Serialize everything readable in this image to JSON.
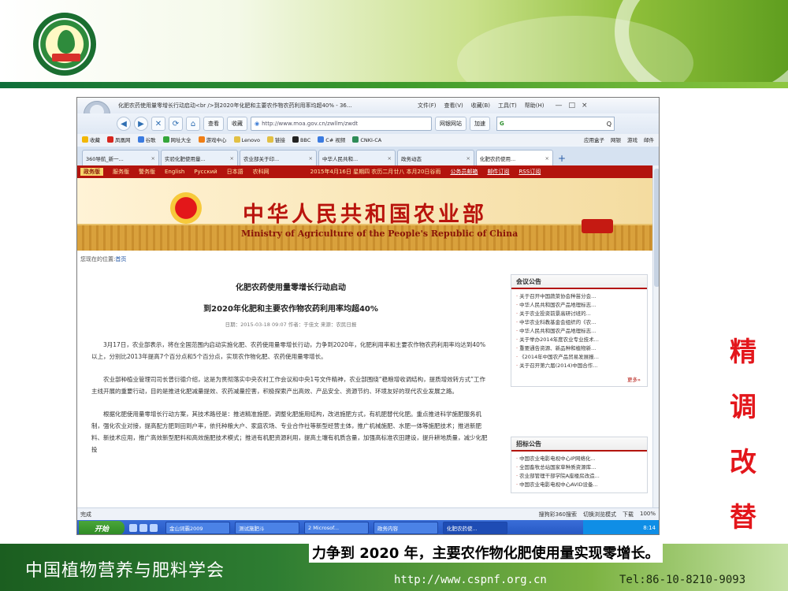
{
  "slide": {
    "vertical_title": [
      "精",
      "调",
      "改",
      "替"
    ],
    "caption": "力争到 2020 年，主要农作物化肥使用量实现零增长。",
    "footer_org": "中国植物营养与肥料学会",
    "footer_url": "http://www.cspnf.org.cn",
    "footer_tel": "Tel:86-10-8210-9093"
  },
  "browser": {
    "window_title": "化肥农药使用量零增长行动启动<br />到2020年化肥和主要农作物农药利用率均超40% - 36...",
    "menus": [
      "文件(F)",
      "查看(V)",
      "收藏(B)",
      "工具(T)",
      "帮助(H)"
    ],
    "window_buttons": [
      "—",
      "□",
      "×"
    ],
    "nav": {
      "back": "◀",
      "forward": "▶",
      "stop": "✕",
      "refresh": "⟳",
      "home": "⌂",
      "history": "查看",
      "favorites": "收藏",
      "address": "http://www.moa.gov.cn/zwllm/zwdt",
      "site_label": "网银网站",
      "extra": "加速",
      "search_placeholder": "",
      "search_go": "Q"
    },
    "favorites": [
      "收藏",
      "凤凰网",
      "谷歌",
      "网址大全",
      "游戏中心",
      "Lenovo",
      "链接",
      "BBC",
      "C# 视频",
      "CNKI-CA"
    ],
    "favorites_right": [
      "应用盒子",
      "网银",
      "游戏",
      "邮件"
    ],
    "tabs": [
      {
        "label": "360导航_新一...",
        "active": false
      },
      {
        "label": "实验化肥使用量...",
        "active": false
      },
      {
        "label": "农业部关于印...",
        "active": false
      },
      {
        "label": "中华人民共和...",
        "active": false
      },
      {
        "label": "政务动态",
        "active": false
      },
      {
        "label": "化肥农药使用...",
        "active": true
      }
    ],
    "status_left": "完成",
    "status_right": [
      "搜狗彩360搜索",
      "切换浏览模式",
      "下载",
      "100%"
    ],
    "taskbar": {
      "start": "开始",
      "tasks": [
        "金山词霸2009",
        "测试施肥斗",
        "2 Microsof...",
        "政务内容",
        "化肥农药使..."
      ],
      "clock": "8:14"
    }
  },
  "site": {
    "nav_items": [
      "政务版",
      "服务版",
      "警务版",
      "English",
      "Pусский",
      "日本語",
      "农科网"
    ],
    "date_line": "2015年4月16日 星期四 农历二月廿八 本月20日谷雨",
    "links": [
      "公务员邮箱",
      "邮件订阅",
      "RSS订阅"
    ],
    "banner_cn": "中华人民共和国农业部",
    "banner_en": "Ministry of Agriculture of the People's Republic of China",
    "breadcrumb_prefix": "您现在的位置:",
    "breadcrumb_home": "首页",
    "article": {
      "title1": "化肥农药使用量零增长行动启动",
      "title2": "到2020年化肥和主要农作物农药利用率均超40%",
      "meta": "日期：2015-03-18 09:07   作者：于佳文   来源：农民日报",
      "paragraphs": [
        "3月17日，农业部表示，将在全国范围内启动实施化肥、农药使用量零增长行动，力争到2020年，化肥利用率和主要农作物农药利用率均达到40%以上，分别比2013年提高7个百分点和5个百分点，实现农作物化肥、农药使用量零增长。",
        "农业部种植业管理司司长曾衍德介绍，这是为贯彻落实中央农村工作会议和中央1号文件精神，农业部围绕“稳粮增收调结构，提质增效转方式”工作主线开展的重要行动，目的是推进化肥减量提效、农药减量控害，积极探索产出高效、产品安全、资源节约、环境友好的现代农业发展之路。",
        "根据化肥使用量零增长行动方案，其技术路径是：推进精准施肥，调整化肥施用结构，改进施肥方式，有机肥替代化肥。重点推进科学施肥服务机制，强化农业对接，提高配方肥到田到户率，依托种粮大户、家庭农场、专业合作社等新型经营主体，推广机械施肥、水肥一体等施肥技术；推进新肥料、新技术应用，推广高效新型肥料和高效施肥技术模式；推进有机肥资源利用，提高土壤有机质含量，加强高标准农田建设，提升耕地质量，减少化肥投"
      ]
    },
    "notice_box": {
      "title": "会议公告",
      "items": [
        "关于召开中国蔬菜协会种苗分会...",
        "中华人民共和国农产品地理标志...",
        "关于农业投资前景高研讨班的...",
        "中华农业科教基金会组织的《农...",
        "中华人民共和国农产品地理标志...",
        "关于举办2014年度农业专业技术...",
        "重要通告资源、新品种和植物新...",
        "《2014年中国农产品贸易发展报...",
        "关于召开第六届(2014)中国合作..."
      ],
      "more": "更多»"
    },
    "tender_box": {
      "title": "招标公告",
      "items": [
        "中国农业电影电视中心IP网络化...",
        "全国畜牧总站国家草种质资源库...",
        "农业部管理干部学院A座楼房改造...",
        "中国农业电影电视中心AVID设备..."
      ]
    }
  }
}
